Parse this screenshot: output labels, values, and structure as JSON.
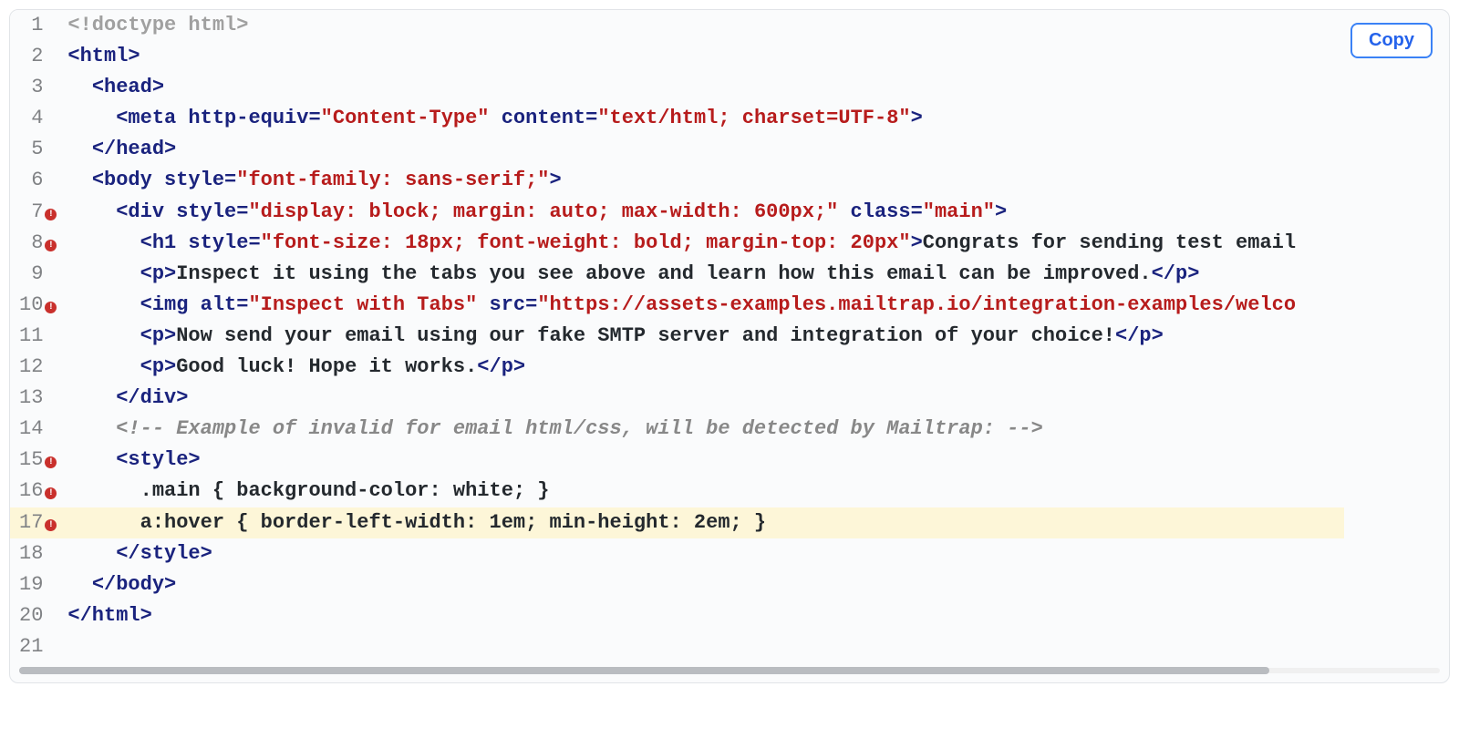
{
  "copy_button_label": "Copy",
  "error_marker_glyph": "!",
  "lines": [
    {
      "num": 1,
      "error": false,
      "highlighted": false,
      "indent": "",
      "tokens": [
        {
          "cls": "tok-doctype",
          "text": "<!doctype html>"
        }
      ]
    },
    {
      "num": 2,
      "error": false,
      "highlighted": false,
      "indent": "",
      "tokens": [
        {
          "cls": "tok-tag",
          "text": "<html>"
        }
      ]
    },
    {
      "num": 3,
      "error": false,
      "highlighted": false,
      "indent": "  ",
      "tokens": [
        {
          "cls": "tok-tag",
          "text": "<head>"
        }
      ]
    },
    {
      "num": 4,
      "error": false,
      "highlighted": false,
      "indent": "    ",
      "tokens": [
        {
          "cls": "tok-tag",
          "text": "<meta"
        },
        {
          "cls": "tok-attr",
          "text": " http-equiv="
        },
        {
          "cls": "tok-str",
          "text": "\"Content-Type\""
        },
        {
          "cls": "tok-attr",
          "text": " content="
        },
        {
          "cls": "tok-str",
          "text": "\"text/html; charset=UTF-8\""
        },
        {
          "cls": "tok-tag",
          "text": ">"
        }
      ]
    },
    {
      "num": 5,
      "error": false,
      "highlighted": false,
      "indent": "  ",
      "tokens": [
        {
          "cls": "tok-tag",
          "text": "</head>"
        }
      ]
    },
    {
      "num": 6,
      "error": false,
      "highlighted": false,
      "indent": "  ",
      "tokens": [
        {
          "cls": "tok-tag",
          "text": "<body"
        },
        {
          "cls": "tok-attr",
          "text": " style="
        },
        {
          "cls": "tok-str",
          "text": "\"font-family: sans-serif;\""
        },
        {
          "cls": "tok-tag",
          "text": ">"
        }
      ]
    },
    {
      "num": 7,
      "error": true,
      "highlighted": false,
      "indent": "    ",
      "tokens": [
        {
          "cls": "tok-tag",
          "text": "<div"
        },
        {
          "cls": "tok-attr",
          "text": " style="
        },
        {
          "cls": "tok-str",
          "text": "\"display: block; margin: auto; max-width: 600px;\""
        },
        {
          "cls": "tok-attr",
          "text": " class="
        },
        {
          "cls": "tok-str",
          "text": "\"main\""
        },
        {
          "cls": "tok-tag",
          "text": ">"
        }
      ]
    },
    {
      "num": 8,
      "error": true,
      "highlighted": false,
      "indent": "      ",
      "tokens": [
        {
          "cls": "tok-tag",
          "text": "<h1"
        },
        {
          "cls": "tok-attr",
          "text": " style="
        },
        {
          "cls": "tok-str",
          "text": "\"font-size: 18px; font-weight: bold; margin-top: 20px\""
        },
        {
          "cls": "tok-tag",
          "text": ">"
        },
        {
          "cls": "tok-text",
          "text": "Congrats for sending test email "
        }
      ]
    },
    {
      "num": 9,
      "error": false,
      "highlighted": false,
      "indent": "      ",
      "tokens": [
        {
          "cls": "tok-tag",
          "text": "<p>"
        },
        {
          "cls": "tok-text",
          "text": "Inspect it using the tabs you see above and learn how this email can be improved."
        },
        {
          "cls": "tok-tag",
          "text": "</p>"
        }
      ]
    },
    {
      "num": 10,
      "error": true,
      "highlighted": false,
      "indent": "      ",
      "tokens": [
        {
          "cls": "tok-tag",
          "text": "<img"
        },
        {
          "cls": "tok-attr",
          "text": " alt="
        },
        {
          "cls": "tok-str",
          "text": "\"Inspect with Tabs\""
        },
        {
          "cls": "tok-attr",
          "text": " src="
        },
        {
          "cls": "tok-str",
          "text": "\"https://assets-examples.mailtrap.io/integration-examples/welco"
        }
      ]
    },
    {
      "num": 11,
      "error": false,
      "highlighted": false,
      "indent": "      ",
      "tokens": [
        {
          "cls": "tok-tag",
          "text": "<p>"
        },
        {
          "cls": "tok-text",
          "text": "Now send your email using our fake SMTP server and integration of your choice!"
        },
        {
          "cls": "tok-tag",
          "text": "</p>"
        }
      ]
    },
    {
      "num": 12,
      "error": false,
      "highlighted": false,
      "indent": "      ",
      "tokens": [
        {
          "cls": "tok-tag",
          "text": "<p>"
        },
        {
          "cls": "tok-text",
          "text": "Good luck! Hope it works."
        },
        {
          "cls": "tok-tag",
          "text": "</p>"
        }
      ]
    },
    {
      "num": 13,
      "error": false,
      "highlighted": false,
      "indent": "    ",
      "tokens": [
        {
          "cls": "tok-tag",
          "text": "</div>"
        }
      ]
    },
    {
      "num": 14,
      "error": false,
      "highlighted": false,
      "indent": "    ",
      "tokens": [
        {
          "cls": "tok-comment",
          "text": "<!-- Example of invalid for email html/css, will be detected by Mailtrap: -->"
        }
      ]
    },
    {
      "num": 15,
      "error": true,
      "highlighted": false,
      "indent": "    ",
      "tokens": [
        {
          "cls": "tok-tag",
          "text": "<style>"
        }
      ]
    },
    {
      "num": 16,
      "error": true,
      "highlighted": false,
      "indent": "      ",
      "tokens": [
        {
          "cls": "tok-css",
          "text": ".main { background-color: white; }"
        }
      ]
    },
    {
      "num": 17,
      "error": true,
      "highlighted": true,
      "indent": "      ",
      "tokens": [
        {
          "cls": "tok-css",
          "text": "a:hover { border-left-width: 1em; min-height: 2em; }"
        }
      ]
    },
    {
      "num": 18,
      "error": false,
      "highlighted": false,
      "indent": "    ",
      "tokens": [
        {
          "cls": "tok-tag",
          "text": "</style>"
        }
      ]
    },
    {
      "num": 19,
      "error": false,
      "highlighted": false,
      "indent": "  ",
      "tokens": [
        {
          "cls": "tok-tag",
          "text": "</body>"
        }
      ]
    },
    {
      "num": 20,
      "error": false,
      "highlighted": false,
      "indent": "",
      "tokens": [
        {
          "cls": "tok-tag",
          "text": "</html>"
        }
      ]
    },
    {
      "num": 21,
      "error": false,
      "highlighted": false,
      "indent": "",
      "tokens": []
    }
  ]
}
